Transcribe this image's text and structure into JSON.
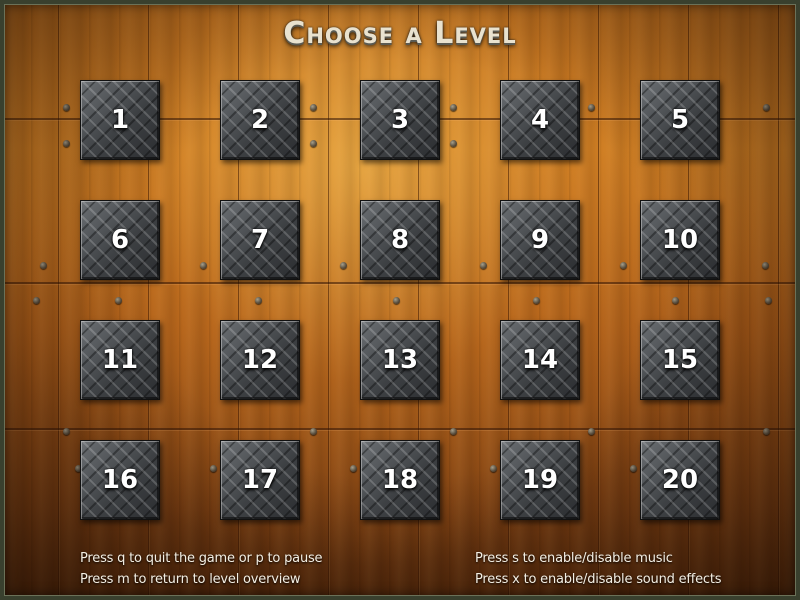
{
  "title": "Choose a Level",
  "levels": [
    "1",
    "2",
    "3",
    "4",
    "5",
    "6",
    "7",
    "8",
    "9",
    "10",
    "11",
    "12",
    "13",
    "14",
    "15",
    "16",
    "17",
    "18",
    "19",
    "20"
  ],
  "help": {
    "left_line1": "Press q to quit the game or p to pause",
    "left_line2": "Press m to return to level overview",
    "right_line1": "Press s to enable/disable music",
    "right_line2": "Press x to enable/disable sound effects"
  }
}
